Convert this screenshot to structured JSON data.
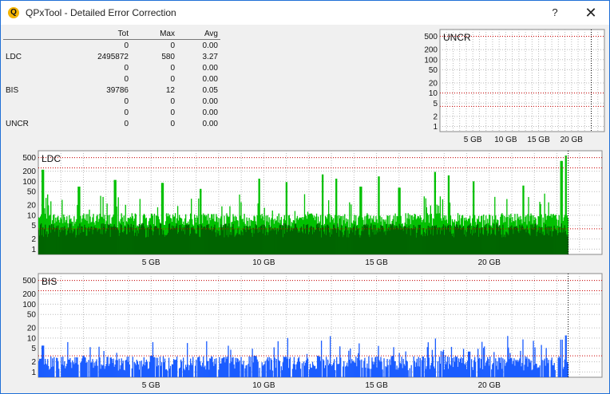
{
  "window": {
    "title": "QPxTool - Detailed Error Correction",
    "help_label": "?",
    "close_label": "✕",
    "app_icon": "Q"
  },
  "stats": {
    "headers": [
      "",
      "Tot",
      "Max",
      "Avg"
    ],
    "rows": [
      [
        "",
        "0",
        "0",
        "0.00"
      ],
      [
        "LDC",
        "2495872",
        "580",
        "3.27"
      ],
      [
        "",
        "0",
        "0",
        "0.00"
      ],
      [
        "",
        "0",
        "0",
        "0.00"
      ],
      [
        "BIS",
        "39786",
        "12",
        "0.05"
      ],
      [
        "",
        "0",
        "0",
        "0.00"
      ],
      [
        "",
        "0",
        "0",
        "0.00"
      ],
      [
        "UNCR",
        "0",
        "0",
        "0.00"
      ]
    ]
  },
  "chart_data": [
    {
      "id": "uncr",
      "type": "bar",
      "title": "UNCR",
      "scale": "log",
      "y_ticks": [
        1,
        2,
        5,
        10,
        20,
        50,
        100,
        200,
        500
      ],
      "x_ticks": [
        "5 GB",
        "10 GB",
        "15 GB",
        "20 GB"
      ],
      "x_tick_values": [
        5,
        10,
        15,
        20
      ],
      "x_range": [
        0,
        25
      ],
      "y_range": [
        0.7,
        800
      ],
      "red_lines": [
        4,
        10,
        500
      ],
      "end_marker": 23,
      "bar_color": "#0000ff",
      "values": []
    },
    {
      "id": "ldc",
      "type": "bar",
      "title": "LDC",
      "scale": "log",
      "y_ticks": [
        1,
        2,
        5,
        10,
        20,
        50,
        100,
        200,
        500
      ],
      "x_ticks": [
        "5 GB",
        "10 GB",
        "15 GB",
        "20 GB"
      ],
      "x_tick_values": [
        5,
        10,
        15,
        20
      ],
      "x_range": [
        0,
        25
      ],
      "y_range": [
        0.7,
        800
      ],
      "red_lines": [
        4,
        250,
        500
      ],
      "end_marker": 23.5,
      "series": [
        {
          "name": "",
          "color": "#00c000",
          "typical": 8,
          "peak": 580,
          "peak_at": 23.4,
          "spikes": [
            [
              0.2,
              220
            ],
            [
              1.8,
              70
            ],
            [
              3.4,
              110
            ],
            [
              5.5,
              90
            ],
            [
              7.2,
              60
            ],
            [
              9.8,
              120
            ],
            [
              11.0,
              95
            ],
            [
              12.6,
              160
            ],
            [
              13.2,
              120
            ],
            [
              14.3,
              70
            ],
            [
              15.1,
              140
            ],
            [
              16.0,
              65
            ],
            [
              17.6,
              190
            ],
            [
              18.2,
              150
            ],
            [
              19.3,
              100
            ],
            [
              21.5,
              75
            ],
            [
              23.2,
              400
            ],
            [
              23.4,
              580
            ]
          ]
        },
        {
          "name": "",
          "color": "#006400",
          "typical": 4
        }
      ]
    },
    {
      "id": "bis",
      "type": "bar",
      "title": "BIS",
      "scale": "log",
      "y_ticks": [
        1,
        2,
        5,
        10,
        20,
        50,
        100,
        200,
        500
      ],
      "x_ticks": [
        "5 GB",
        "10 GB",
        "15 GB",
        "20 GB"
      ],
      "x_tick_values": [
        5,
        10,
        15,
        20
      ],
      "x_range": [
        0,
        25
      ],
      "y_range": [
        0.7,
        800
      ],
      "red_lines": [
        3,
        250,
        500
      ],
      "end_marker": 23.5,
      "series": [
        {
          "name": "",
          "color": "#1a5cff",
          "typical": 2,
          "peak": 12,
          "peak_at": 23.4,
          "spikes": [
            [
              0.2,
              6
            ],
            [
              2.0,
              3
            ],
            [
              5.0,
              3
            ],
            [
              9.6,
              3
            ],
            [
              12.4,
              3
            ],
            [
              15.7,
              3
            ],
            [
              17.9,
              4
            ],
            [
              19.1,
              4
            ],
            [
              23.2,
              9
            ],
            [
              23.4,
              12
            ]
          ]
        }
      ]
    }
  ]
}
